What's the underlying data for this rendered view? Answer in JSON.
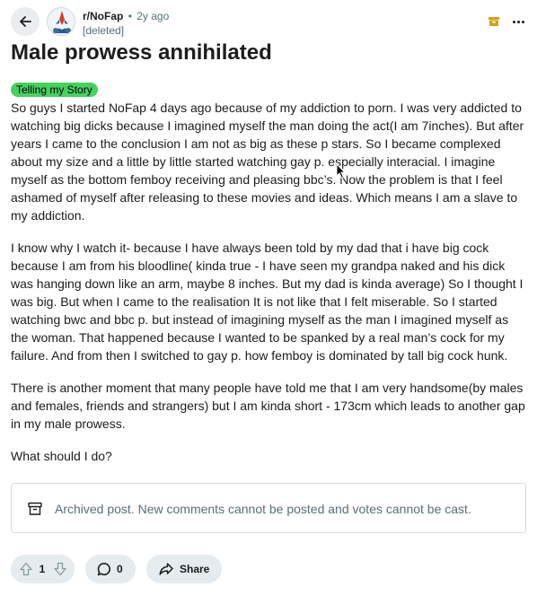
{
  "header": {
    "subreddit": "r/NoFap",
    "separator": "•",
    "age": "2y ago",
    "author": "[deleted]"
  },
  "post": {
    "title": "Male prowess annihilated",
    "flair": "Telling my Story",
    "paragraphs": [
      "So guys I started NoFap 4 days ago because of my addiction to porn. I was very addicted to watching big dicks because I imagined myself the man doing the act(I am 7inches). But after years I came to the conclusion I am not as big as these p stars. So I became complexed about my size and a little by little started watching gay p. especially interacial. I imagine myself as the bottom femboy receiving and pleasing bbc’s. Now the problem is that I feel ashamed of myself after releasing to these movies and ideas. Which means I am a slave to my addiction.",
      "I know why I watch it- because I have always been told by my dad that i have big cock because I am from his bloodline( kinda true - I have seen my grandpa naked and his dick was hanging down like an arm, maybe 8 inches. But my dad is kinda average) So I thought I was big. But when I came to the realisation It is not like that I felt miserable. So I started watching bwc and bbc p. but instead of imagining myself as the man I imagined myself as the woman. That happened because I wanted to be spanked by a real man’s cock for my failure. And from then I switched to gay p. how femboy is dominated by tall big cock hunk.",
      "There is another moment that many people have told me that I am very handsome(by males and females, friends and strangers) but I am kinda short - 173cm which leads to another gap in my male prowess.",
      "What should I do?"
    ]
  },
  "archived": {
    "message": "Archived post. New comments cannot be posted and votes cannot be cast."
  },
  "actions": {
    "votes": "1",
    "comments": "0",
    "share": "Share"
  },
  "colors": {
    "flair": "#46d160",
    "pill": "#e5ebee",
    "archive_badge": "#d4a017"
  },
  "icons": [
    "back-arrow-icon",
    "subreddit-avatar",
    "archive-badge-icon",
    "more-icon",
    "archive-icon",
    "upvote-icon",
    "downvote-icon",
    "comment-icon",
    "share-icon",
    "mouse-cursor"
  ]
}
